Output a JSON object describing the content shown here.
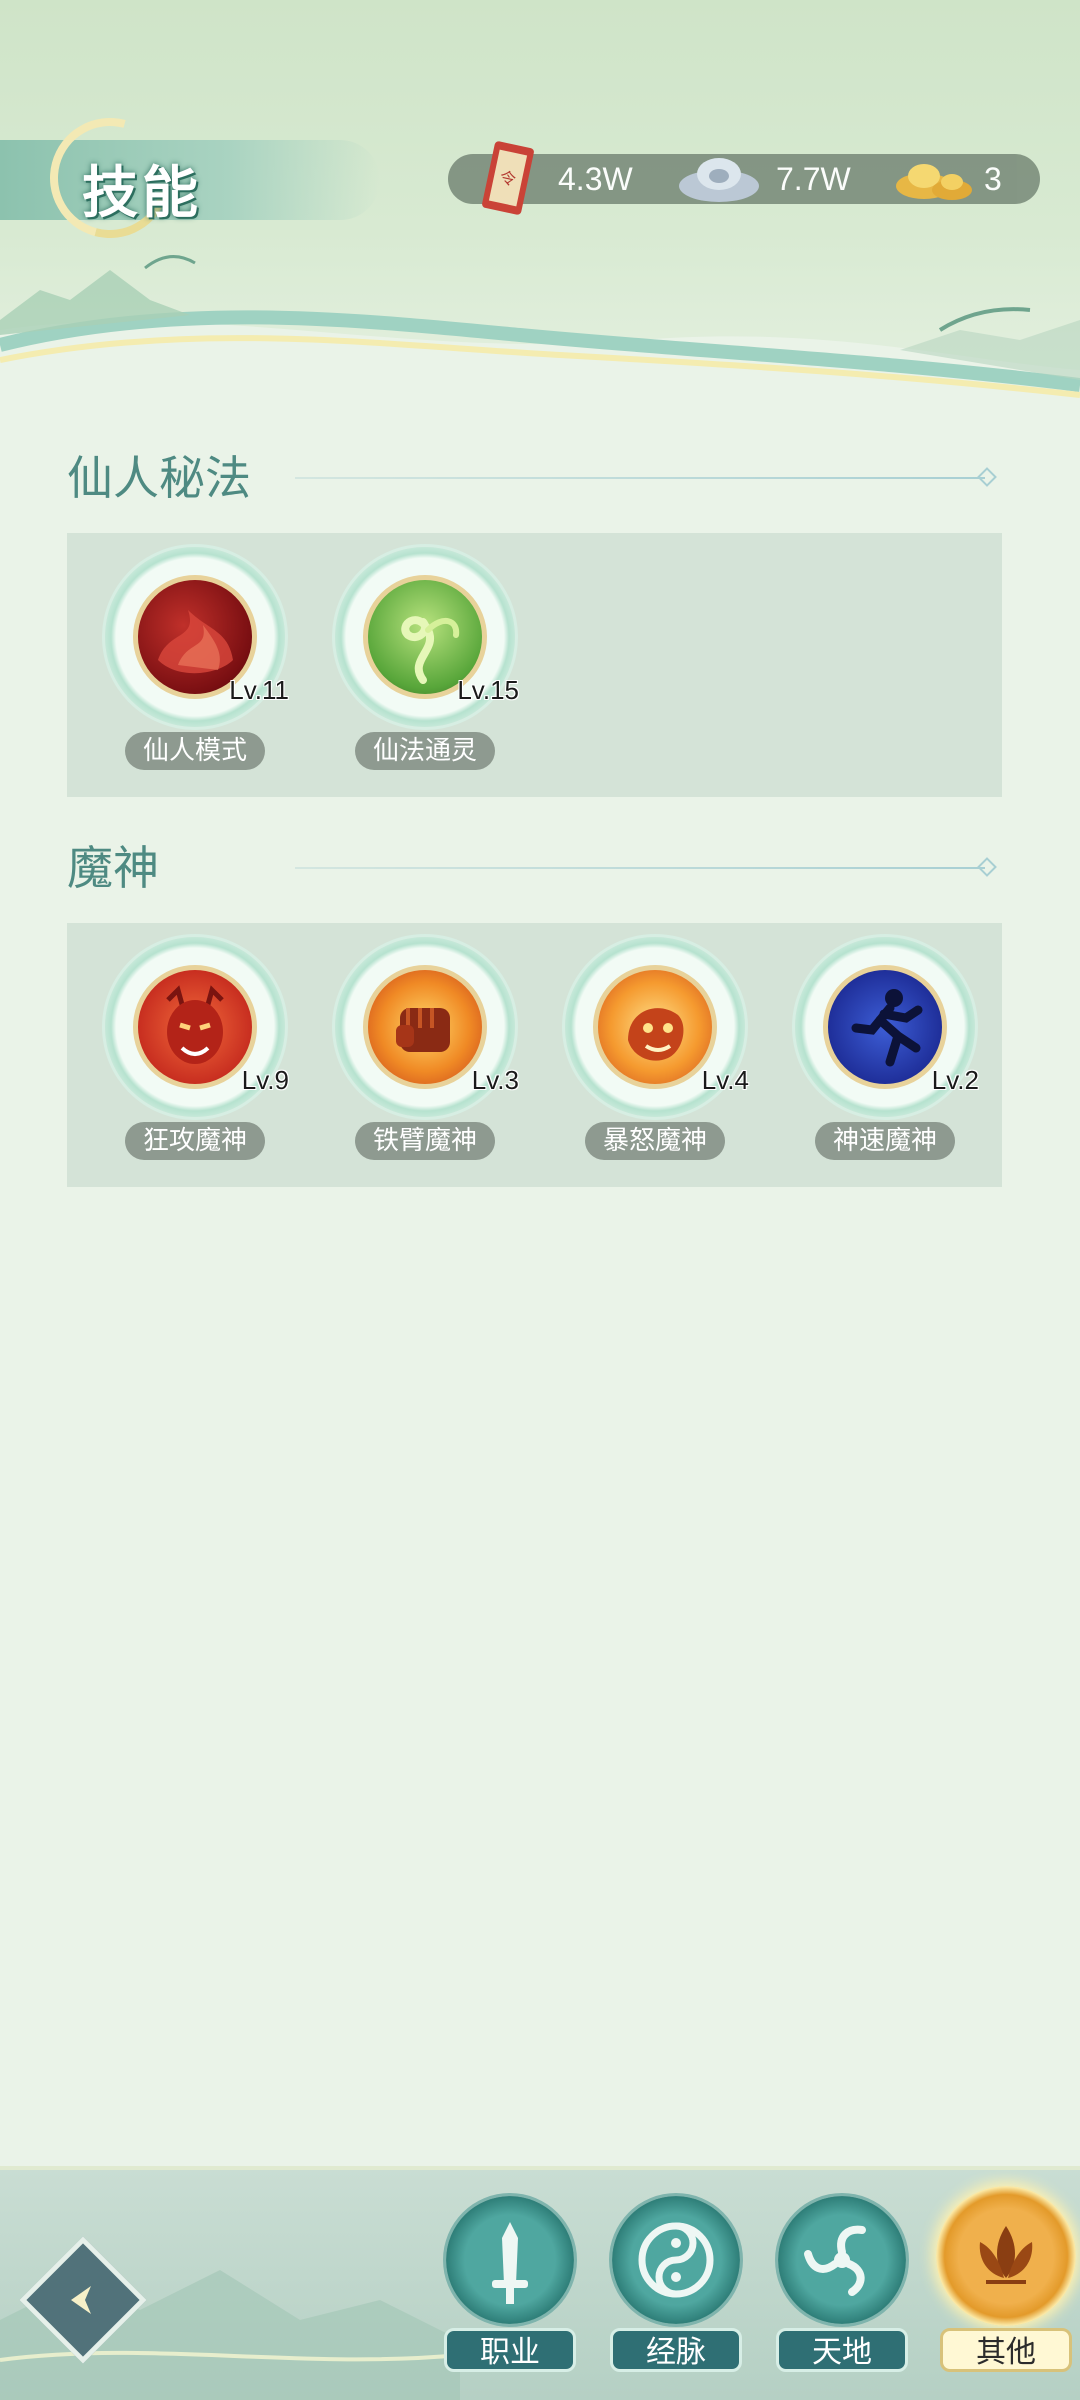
{
  "header": {
    "title": "技能"
  },
  "currency": {
    "items": [
      {
        "icon": "token-scroll-icon",
        "value": "4.3W"
      },
      {
        "icon": "silver-ingot-icon",
        "value": "7.7W"
      },
      {
        "icon": "gold-ingot-icon",
        "value": "3"
      }
    ]
  },
  "sections": [
    {
      "title": "仙人秘法",
      "skills": [
        {
          "name": "仙人模式",
          "level": "Lv.11",
          "icon": "red-flame-icon"
        },
        {
          "name": "仙法通灵",
          "level": "Lv.15",
          "icon": "green-vine-icon"
        }
      ]
    },
    {
      "title": "魔神",
      "skills": [
        {
          "name": "狂攻魔神",
          "level": "Lv.9",
          "icon": "demon-face-icon"
        },
        {
          "name": "铁臂魔神",
          "level": "Lv.3",
          "icon": "flaming-fist-icon"
        },
        {
          "name": "暴怒魔神",
          "level": "Lv.4",
          "icon": "fire-tiger-icon"
        },
        {
          "name": "神速魔神",
          "level": "Lv.2",
          "icon": "running-silhouette-icon"
        }
      ]
    }
  ],
  "bottom_nav": {
    "items": [
      {
        "label": "职业",
        "icon": "sword-icon",
        "active": false
      },
      {
        "label": "经脉",
        "icon": "taiji-icon",
        "active": false
      },
      {
        "label": "天地",
        "icon": "triskelion-icon",
        "active": false
      },
      {
        "label": "其他",
        "icon": "lotus-icon",
        "active": true
      }
    ]
  },
  "colors": {
    "background": "#eaf3e8",
    "panel": "#d4e3d7",
    "section_title": "#4e8a82",
    "nav_teal": "#2f6f74",
    "nav_active": "#f0b04c"
  }
}
